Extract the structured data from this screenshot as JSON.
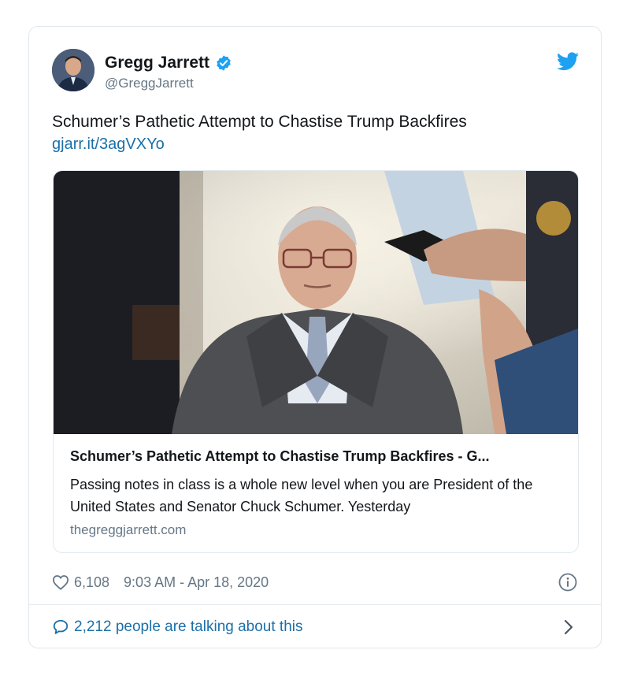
{
  "author": {
    "name": "Gregg Jarrett",
    "handle": "@GreggJarrett",
    "verified": true
  },
  "tweet": {
    "text": "Schumer’s Pathetic Attempt to Chastise Trump Backfires",
    "link": "gjarr.it/3agVXYo"
  },
  "link_card": {
    "title": "Schumer’s Pathetic Attempt to Chastise Trump Backfires - G...",
    "description": "Passing notes in class is a whole new level when you are President of the United States and Senator Chuck Schumer. Yesterday",
    "domain": "thegreggjarrett.com"
  },
  "meta": {
    "likes": "6,108",
    "timestamp": "9:03 AM - Apr 18, 2020"
  },
  "footer": {
    "talking": "2,212 people are talking about this"
  },
  "icons": {
    "verified": "verified-badge-icon",
    "bird": "twitter-bird-icon",
    "heart": "heart-icon",
    "info": "info-icon",
    "bubble": "speech-bubble-icon",
    "chevron": "chevron-right-icon"
  },
  "colors": {
    "accent": "#1da1f2",
    "link": "#1b6fa8",
    "muted": "#657786",
    "border": "#e1e8ed"
  }
}
